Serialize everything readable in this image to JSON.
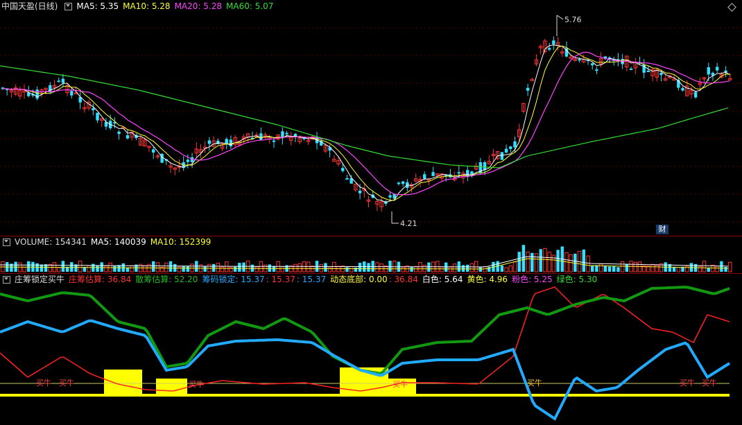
{
  "main": {
    "title": "中国天盈(日线)",
    "ma5_label": "MA5: 5.35",
    "ma10_label": "MA10: 5.28",
    "ma20_label": "MA20: 5.28",
    "ma60_label": "MA60: 5.07",
    "high_marker": "5.76",
    "low_marker": "4.21",
    "badge": "财"
  },
  "volume": {
    "title": "VOLUME: 154341",
    "ma5_label": "MA5: 140039",
    "ma10_label": "MA10: 152399"
  },
  "indicator": {
    "title": "庄筹锁定买牛",
    "zhuang_label": "庄筹估算: 36.84",
    "san_label": "散筹估算: 52.20",
    "suo_label": "筹码锁定: 15.37",
    "v1_label": ": 15.37",
    "v2_label": ": 15.37",
    "dongtai_label": "动态底部: 0.00",
    "v3_label": ": 36.84",
    "white_label": "白色: 5.64",
    "yellow_label": "黄色: 4.96",
    "pink_label": "粉色: 5.25",
    "green_label": "绿色: 5.30",
    "buy_label": "买牛"
  },
  "colors": {
    "up": "#ff3333",
    "down": "#33e0ff",
    "ma5": "#ffffff",
    "ma10": "#ffff33",
    "ma20": "#ff44ff",
    "ma60": "#33dd33",
    "zhuang": "#ff2222",
    "san": "#119911",
    "suo": "#22aaff",
    "bottom": "#ffff00"
  }
}
